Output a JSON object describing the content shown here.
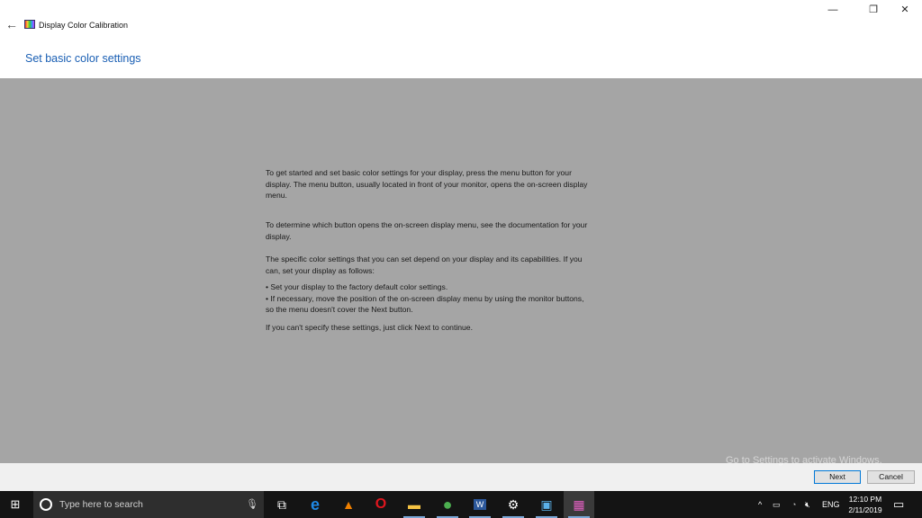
{
  "window": {
    "title": "Display Color Calibration",
    "heading": "Set basic color settings",
    "back_icon": "arrow-left-icon",
    "controls": {
      "minimize": "—",
      "restore": "❐",
      "close": "✕"
    }
  },
  "content": {
    "paragraphs": [
      [
        "To get started and set basic color settings for your display, press the menu button for your",
        "display. The menu button, usually located in front of your monitor, opens the on-screen display",
        "menu."
      ],
      [
        "To determine which button opens the on-screen display menu, see the documentation for your",
        "display."
      ],
      [
        "The specific color settings that you can set depend on your display and its capabilities. If you",
        "can, set your display as follows:"
      ],
      [
        "• Set your display to the factory default color settings.",
        "• If necessary, move the position of the on-screen display menu by using the monitor buttons,",
        "so the menu doesn't cover the Next button."
      ],
      [
        "If you can't specify these settings,  just click Next to continue."
      ]
    ]
  },
  "footer": {
    "watermark": "Go to Settings to activate Windows.",
    "next": "Next",
    "cancel": "Cancel",
    "next_border": "#0078d7"
  },
  "taskbar": {
    "search_placeholder": "Type here to search",
    "apps": [
      {
        "name": "task-view",
        "glyph": "⧉",
        "color": "#fff"
      },
      {
        "name": "edge",
        "glyph": "e",
        "color": "#1e88e5"
      },
      {
        "name": "vlc",
        "glyph": "▲",
        "color": "#f08000"
      },
      {
        "name": "opera",
        "glyph": "O",
        "color": "#e0161e"
      },
      {
        "name": "file-explorer",
        "glyph": "▬",
        "color": "#f6c343"
      },
      {
        "name": "chrome",
        "glyph": "●",
        "color": "#4caf50"
      },
      {
        "name": "word",
        "glyph": "W",
        "color": "#2b579a"
      },
      {
        "name": "settings",
        "glyph": "⚙",
        "color": "#fff"
      },
      {
        "name": "display-monitor",
        "glyph": "▣",
        "color": "#5ab0e8"
      },
      {
        "name": "color-calibration",
        "glyph": "▦",
        "color": "#e060c0"
      }
    ],
    "tray": {
      "chevron": "^",
      "language": "ENG",
      "time": "12:10 PM",
      "date": "2/11/2019"
    }
  }
}
